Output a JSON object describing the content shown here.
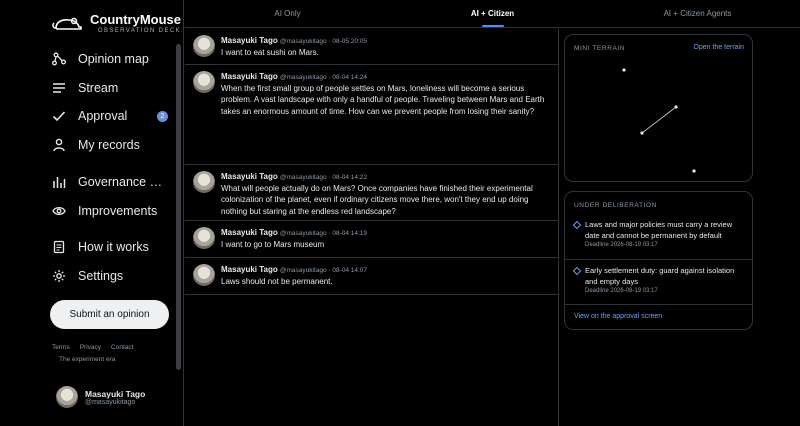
{
  "app": {
    "title": "CountryMouse",
    "subtitle": "OBSERVATION DECK"
  },
  "nav": [
    {
      "label": "Opinion map",
      "icon": "share-nodes-icon"
    },
    {
      "label": "Stream",
      "icon": "lines-icon"
    },
    {
      "label": "Approval",
      "icon": "check-icon",
      "badge": "2"
    },
    {
      "label": "My records",
      "icon": "person-icon"
    },
    {
      "label": "Governance status",
      "icon": "bar-chart-icon"
    },
    {
      "label": "Improvements",
      "icon": "eye-icon"
    },
    {
      "label": "How it works",
      "icon": "document-icon"
    },
    {
      "label": "Settings",
      "icon": "gear-icon"
    }
  ],
  "submit_label": "Submit an opinion",
  "footer": {
    "terms": "Terms",
    "privacy": "Privacy",
    "contact": "Contact",
    "era": "The experiment era"
  },
  "user": {
    "name": "Masayuki Tago",
    "handle": "@masayukitago"
  },
  "tabs": [
    {
      "label": "AI Only"
    },
    {
      "label": "AI + Citizen",
      "active": true
    },
    {
      "label": "AI + Citizen Agents"
    }
  ],
  "posts": [
    {
      "name": "Masayuki Tago",
      "meta": "@masayukitago · 08-05 20:05",
      "text": "I want to eat sushi on Mars."
    },
    {
      "name": "Masayuki Tago",
      "meta": "@masayukitago · 08-04 14:24",
      "text": "When the first small group of people settles on Mars, loneliness will become a serious problem. A vast landscape with only a handful of people. Traveling between Mars and Earth takes an enormous amount of time. How can we prevent people from losing their sanity?"
    },
    {
      "name": "Masayuki Tago",
      "meta": "@masayukitago · 08-04 14:22",
      "text": "What will people actually do on Mars? Once companies have finished their experimental colonization of the planet, even if ordinary citizens move there, won't they end up doing nothing but staring at the endless red landscape?"
    },
    {
      "name": "Masayuki Tago",
      "meta": "@masayukitago · 08-04 14:19",
      "text": "I want to go to Mars museum"
    },
    {
      "name": "Masayuki Tago",
      "meta": "@masayukitago · 08-04 14:07",
      "text": "Laws should not be permanent."
    }
  ],
  "terrain": {
    "title": "MINI TERRAIN",
    "link": "Open the terrain"
  },
  "deliberation": {
    "title": "UNDER DELIBERATION",
    "items": [
      {
        "text": "Laws and major policies must carry a review date and cannot be permanent by default",
        "deadline": "Deadline 2026-08-19 03:17"
      },
      {
        "text": "Early settlement duty: guard against isolation and empty days",
        "deadline": "Deadline 2026-08-19 03:17"
      }
    ],
    "link": "View on the approval screen"
  },
  "colors": {
    "accent": "#4f8ef7",
    "link": "#6ca0f6",
    "badge": "#6b8fd9",
    "border": "#2f3336"
  }
}
